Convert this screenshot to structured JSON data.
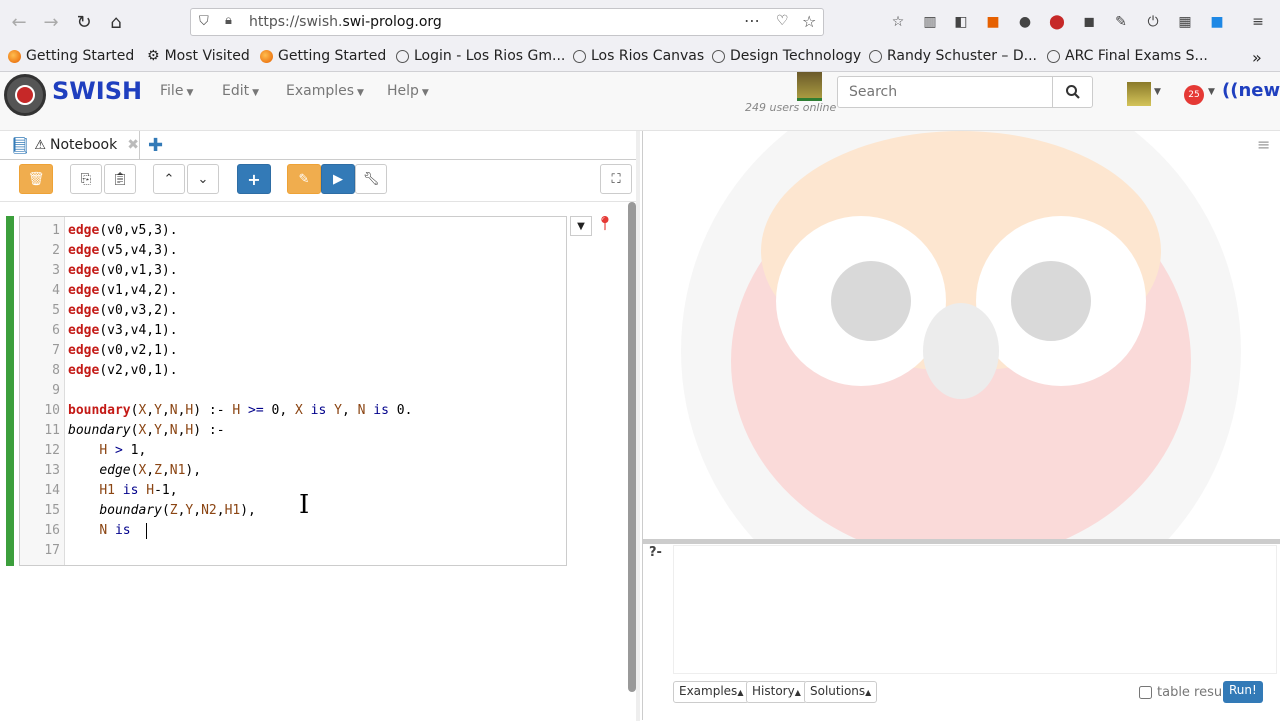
{
  "browser": {
    "url_prefix": "https://swish.",
    "url_domain": "swi-prolog.org",
    "more_icon": "⋯",
    "bookmarks": [
      {
        "label": "Getting Started"
      },
      {
        "label": "Most Visited"
      },
      {
        "label": "Getting Started"
      },
      {
        "label": "Login - Los Rios Gm..."
      },
      {
        "label": "Los Rios Canvas"
      },
      {
        "label": "Design Technology"
      },
      {
        "label": "Randy Schuster – D..."
      },
      {
        "label": "ARC Final Exams S..."
      }
    ],
    "overflow": "»"
  },
  "swish": {
    "brand": "SWISH",
    "menus": {
      "file": "File",
      "edit": "Edit",
      "examples": "Examples",
      "help": "Help"
    },
    "users_online": "249 users online",
    "search_placeholder": "Search",
    "notifications": "25",
    "new_label": "((new))"
  },
  "notebook": {
    "tab_label": "Notebook",
    "lines": [
      "1",
      "2",
      "3",
      "4",
      "5",
      "6",
      "7",
      "8",
      "9",
      "10",
      "11",
      "12",
      "13",
      "14",
      "15",
      "16",
      "17"
    ]
  },
  "query": {
    "prompt": "?-",
    "examples": "Examples",
    "history": "History",
    "solutions": "Solutions",
    "table_results": "table results",
    "run": "Run!"
  },
  "colors": {
    "accent": "#337ab7",
    "brand": "#1f3fbf",
    "cell_bar": "#3c9f3c",
    "keyword": "#c41a16"
  }
}
